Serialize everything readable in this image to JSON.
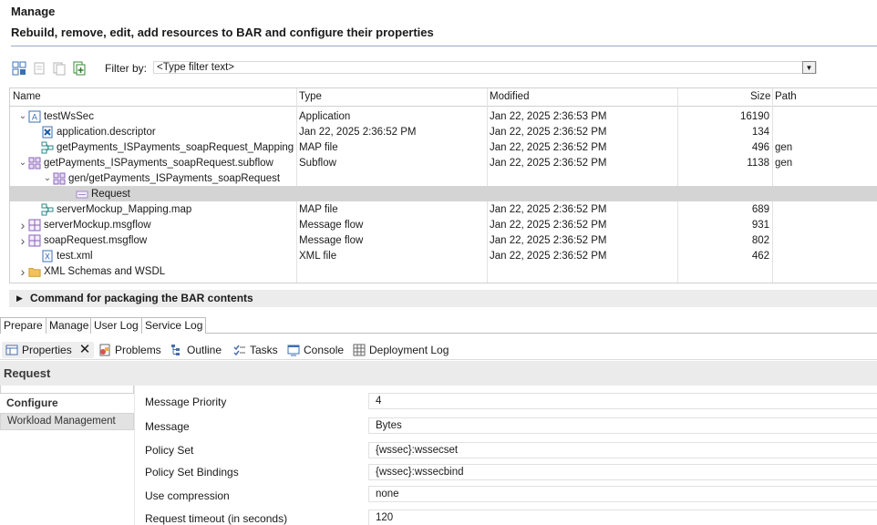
{
  "page": {
    "title": "Manage",
    "subtitle": "Rebuild, remove, edit, add resources to BAR and configure their properties"
  },
  "filter": {
    "label": "Filter by:",
    "placeholder": "<Type filter text>"
  },
  "table": {
    "columns": [
      "Name",
      "Type",
      "Modified",
      "Size",
      "Path"
    ],
    "rows": [
      {
        "name": "testWsSec",
        "type": "Application",
        "modified": "Jan 22, 2025  2:36:53 PM",
        "size": "16190",
        "path": "",
        "icon": "application-icon",
        "expand": "expanded"
      },
      {
        "name": "application.descriptor",
        "type": "Jan 22, 2025  2:36:52 PM",
        "modified": "Jan 22, 2025  2:36:52 PM",
        "size": "134",
        "path": "",
        "icon": "descriptor-icon",
        "expand": ""
      },
      {
        "name": "getPayments_ISPayments_soapRequest_Mapping",
        "type": "MAP file",
        "modified": "Jan 22, 2025  2:36:52 PM",
        "size": "496",
        "path": "gen",
        "icon": "map-file-icon",
        "expand": ""
      },
      {
        "name": "getPayments_ISPayments_soapRequest.subflow",
        "type": "Subflow",
        "modified": "Jan 22, 2025  2:36:52 PM",
        "size": "1138",
        "path": "gen",
        "icon": "subflow-icon",
        "expand": "expanded"
      },
      {
        "name": "gen/getPayments_ISPayments_soapRequest",
        "type": "",
        "modified": "",
        "size": "",
        "path": "",
        "icon": "flow-node-icon",
        "expand": "expanded"
      },
      {
        "name": "Request",
        "type": "",
        "modified": "",
        "size": "",
        "path": "",
        "icon": "request-node-icon",
        "expand": ""
      },
      {
        "name": "serverMockup_Mapping.map",
        "type": "MAP file",
        "modified": "Jan 22, 2025  2:36:52 PM",
        "size": "689",
        "path": "",
        "icon": "map-file-icon",
        "expand": ""
      },
      {
        "name": "serverMockup.msgflow",
        "type": "Message flow",
        "modified": "Jan 22, 2025  2:36:52 PM",
        "size": "931",
        "path": "",
        "icon": "msgflow-icon",
        "expand": "collapsed"
      },
      {
        "name": "soapRequest.msgflow",
        "type": "Message flow",
        "modified": "Jan 22, 2025  2:36:52 PM",
        "size": "802",
        "path": "",
        "icon": "msgflow-icon",
        "expand": "collapsed"
      },
      {
        "name": "test.xml",
        "type": "XML file",
        "modified": "Jan 22, 2025  2:36:52 PM",
        "size": "462",
        "path": "",
        "icon": "xml-file-icon",
        "expand": ""
      },
      {
        "name": "XML Schemas and WSDL",
        "type": "",
        "modified": "",
        "size": "",
        "path": "",
        "icon": "folder-icon",
        "expand": "collapsed"
      }
    ]
  },
  "command_section": {
    "label": "Command for packaging the BAR contents"
  },
  "editor_tabs": [
    "Prepare",
    "Manage",
    "User Log",
    "Service Log"
  ],
  "view_tabs": [
    "Properties",
    "Problems",
    "Outline",
    "Tasks",
    "Console",
    "Deployment Log"
  ],
  "properties": {
    "title": "Request",
    "sidebar": {
      "configure": "Configure",
      "workload": "Workload Management"
    },
    "fields": [
      {
        "label": "Message Priority",
        "value": "4"
      },
      {
        "label": "Message",
        "value": "Bytes"
      },
      {
        "label": "Policy Set",
        "value": "{wssec}:wssecset"
      },
      {
        "label": "Policy Set Bindings",
        "value": "{wssec}:wssecbind"
      },
      {
        "label": "Use compression",
        "value": "none"
      },
      {
        "label": "Request timeout (in seconds)",
        "value": "120"
      }
    ]
  },
  "colors": {
    "selected_row": "#d4d4d4",
    "header_rule": "#9aa8c4"
  }
}
